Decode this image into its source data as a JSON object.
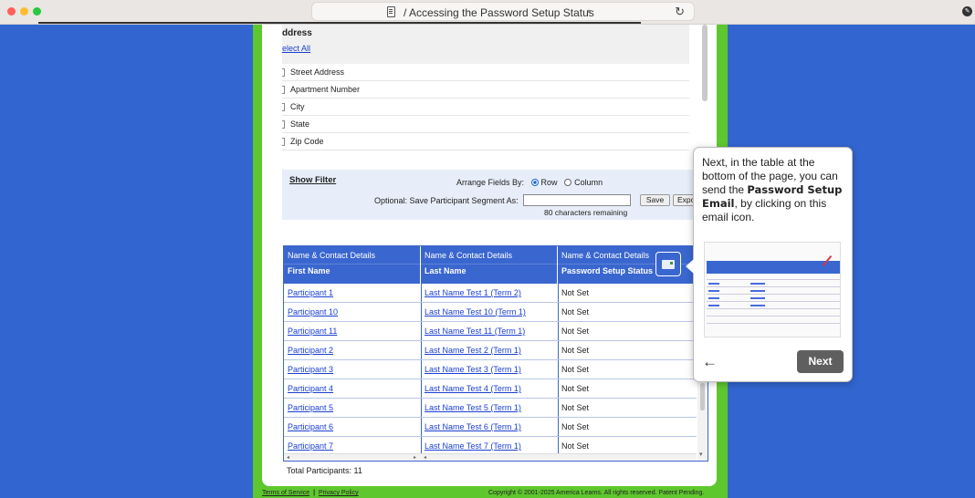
{
  "browser": {
    "tab_title": "/ Accessing the Password Setup Status",
    "reload_icon": "reload-icon",
    "page_icon": "document-icon"
  },
  "address_section": {
    "title": "ddress",
    "select_all": "elect All",
    "fields": [
      "Street Address",
      "Apartment Number",
      "City",
      "State",
      "Zip Code"
    ]
  },
  "filter": {
    "show_filter": "Show Filter",
    "arrange_label": "Arrange Fields By:",
    "option_row": "Row",
    "option_column": "Column",
    "selected": "Row",
    "save_segment_label": "Optional: Save Participant Segment As:",
    "segment_value": "",
    "save_button": "Save",
    "export_button": "Expo",
    "chars_remaining": "80 characters remaining"
  },
  "table": {
    "columns": [
      {
        "group": "Name & Contact Details",
        "name": "First Name"
      },
      {
        "group": "Name & Contact Details",
        "name": "Last Name"
      },
      {
        "group": "Name & Contact Details",
        "name": "Password Setup Status"
      }
    ],
    "rows": [
      [
        "Participant 1",
        "Last Name Test 1 (Term 2)",
        "Not Set"
      ],
      [
        "Participant 10",
        "Last Name Test 10 (Term 1)",
        "Not Set"
      ],
      [
        "Participant 11",
        "Last Name Test 11 (Term 1)",
        "Not Set"
      ],
      [
        "Participant 2",
        "Last Name Test 2 (Term 1)",
        "Not Set"
      ],
      [
        "Participant 3",
        "Last Name Test 3 (Term 1)",
        "Not Set"
      ],
      [
        "Participant 4",
        "Last Name Test 4 (Term 1)",
        "Not Set"
      ],
      [
        "Participant 5",
        "Last Name Test 5 (Term 1)",
        "Not Set"
      ],
      [
        "Participant 6",
        "Last Name Test 6 (Term 1)",
        "Not Set"
      ],
      [
        "Participant 7",
        "Last Name Test 7 (Term 1)",
        "Not Set"
      ]
    ],
    "email_icon": "email-icon",
    "total": "Total Participants: 11"
  },
  "footer": {
    "terms": "Terms of Service",
    "separator": "|",
    "privacy": "Privacy Policy",
    "copyright": "Copyright © 2001-2025 America Learns. All rights reserved. Patent Pending."
  },
  "tooltip": {
    "text_before": "Next, in the table at the bottom of the page, you can send the ",
    "text_bold": "Password Setup Email",
    "text_after": ", by clicking on this email icon.",
    "next_button": "Next",
    "back_icon": "arrow-left-icon"
  },
  "colors": {
    "background": "#3265d0",
    "frame": "#5ec72e",
    "table_header": "#3a66cf",
    "link": "#1a3fd0",
    "next_button": "#5f5f5f"
  }
}
